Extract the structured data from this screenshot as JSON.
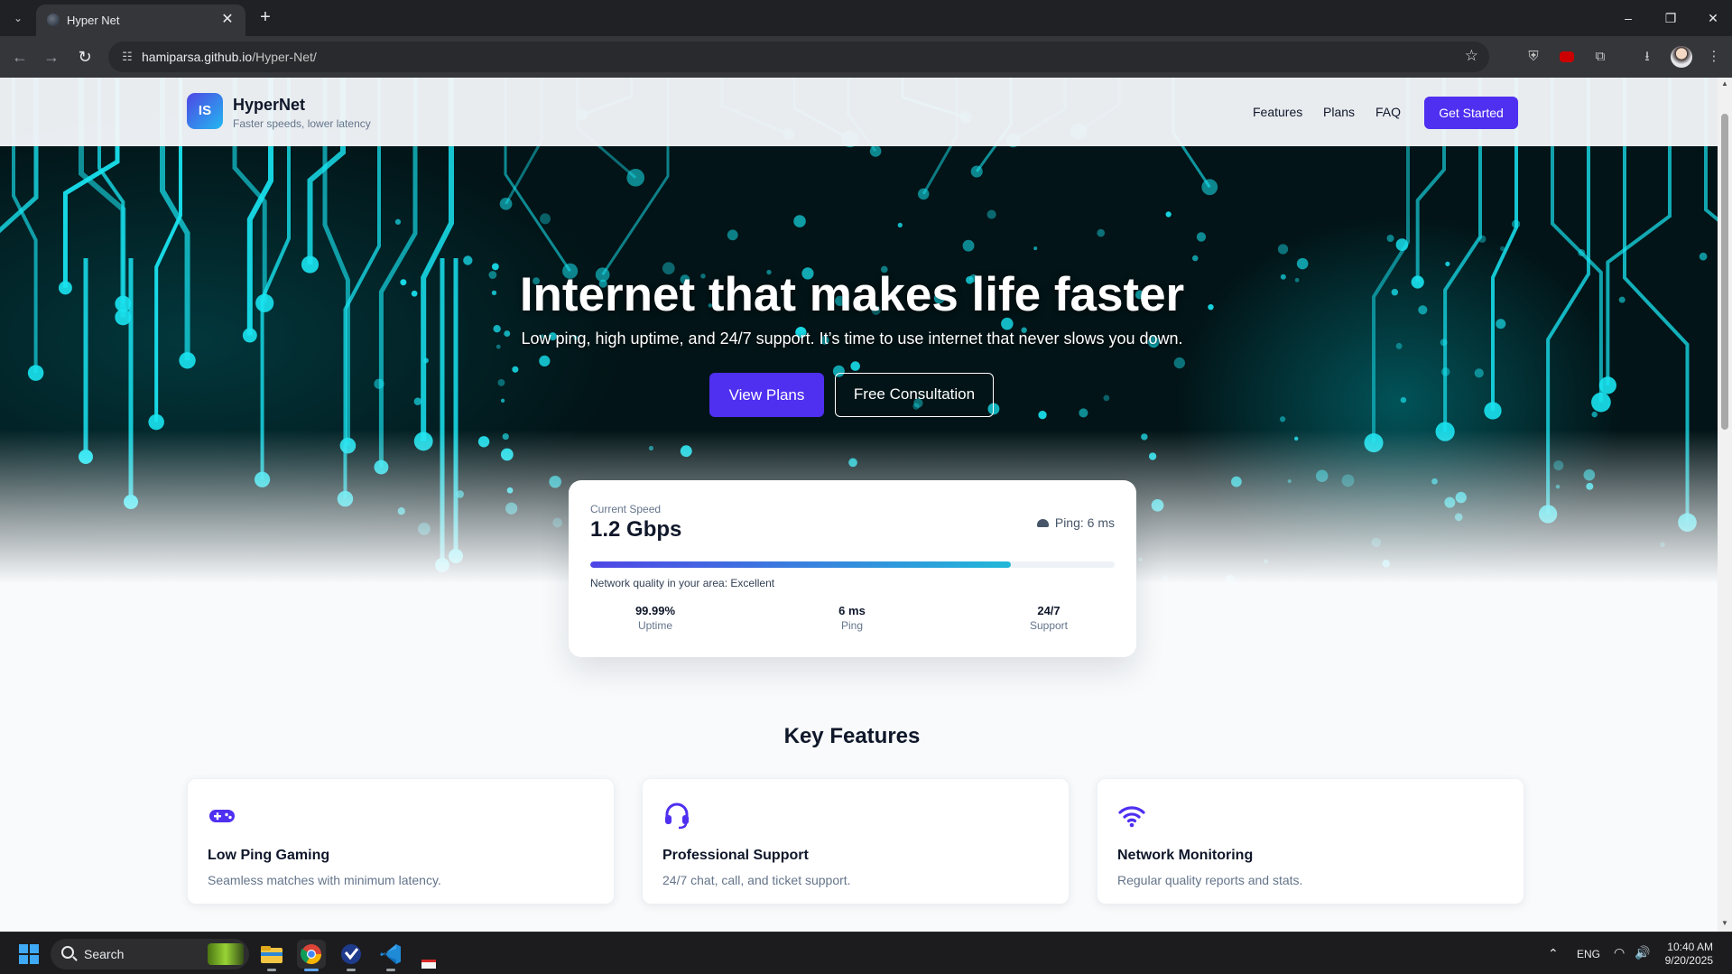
{
  "browser": {
    "tab_title": "Hyper Net",
    "url_host": "hamiparsa.github.io",
    "url_path": "/Hyper-Net/"
  },
  "header": {
    "logo_text": "IS",
    "brand_name": "HyperNet",
    "tagline": "Faster speeds, lower latency",
    "nav": [
      "Features",
      "Plans",
      "FAQ"
    ],
    "cta": "Get Started"
  },
  "hero": {
    "title": "Internet that makes life faster",
    "subtitle": "Low ping, high uptime, and 24/7 support. It’s time to use internet that never slows you down.",
    "primary_button": "View Plans",
    "secondary_button": "Free Consultation"
  },
  "speed_card": {
    "label": "Current Speed",
    "value": "1.2 Gbps",
    "ping": "Ping: 6 ms",
    "progress": 0.802,
    "quality": "Network quality in your area: Excellent",
    "stats": [
      {
        "value": "99.99%",
        "label": "Uptime"
      },
      {
        "value": "6 ms",
        "label": "Ping"
      },
      {
        "value": "24/7",
        "label": "Support"
      }
    ]
  },
  "features": {
    "title": "Key Features",
    "items": [
      {
        "icon": "gamepad-icon",
        "title": "Low Ping Gaming",
        "desc": "Seamless matches with minimum latency."
      },
      {
        "icon": "headset-icon",
        "title": "Professional Support",
        "desc": "24/7 chat, call, and ticket support."
      },
      {
        "icon": "wifi-icon",
        "title": "Network Monitoring",
        "desc": "Regular quality reports and stats."
      }
    ]
  },
  "taskbar": {
    "search_placeholder": "Search",
    "language": "ENG",
    "time": "10:40 AM",
    "date": "9/20/2025"
  },
  "colors": {
    "accent": "#4f2ff0",
    "hero_circuit": "#19e3f0",
    "hero_bg": "#021417"
  }
}
